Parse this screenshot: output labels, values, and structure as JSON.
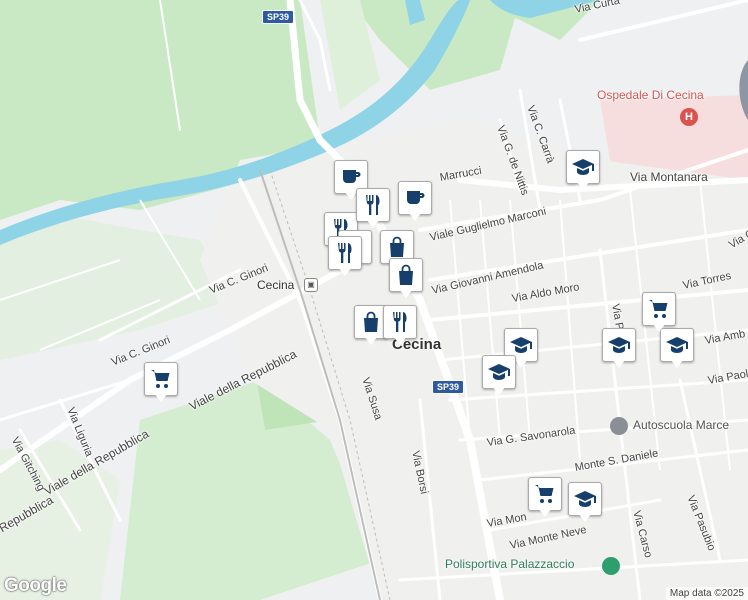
{
  "map": {
    "town": "Cecina",
    "station": "Cecina",
    "hospital": "Ospedale Di Cecina",
    "roads": {
      "sp39_top": "SP39",
      "sp39_bottom": "SP39",
      "via_curtatone": "Via Curta",
      "via_montanara": "Via Montanara",
      "via_marrucci": "Marrucci",
      "via_carra": "Via C. Carrà",
      "via_denittis": "Via G. de Nittis",
      "viale_marconi": "Viale Guglielmo Marconi",
      "via_amendola": "Via Giovanni Amendola",
      "via_aldo_moro": "Via Aldo Moro",
      "via_torres": "Via Torres",
      "via_pa": "Via Pa",
      "via_amb": "Via Amb",
      "via_paol": "Via Paol",
      "via_ginori": "Via C. Ginori",
      "via_ginori2": "Via C. Ginori",
      "viale_repubblica1": "Viale della Repubblica",
      "viale_repubblica2": "Viale della Repubblica",
      "viale_repubblica3": "Repubblica",
      "via_liguria": "Via Liguria",
      "via_gitching": "Via Gitching",
      "via_susa": "Via Susa",
      "via_borsi": "Via Borsi",
      "via_savonarola": "Via G. Savonarola",
      "via_monte_daniele": "Monte S. Daniele",
      "via_mon": "Via Mon",
      "via_monte_neve": "Via Monte Neve",
      "via_carso": "Via Carso",
      "via_pasubio": "Via Pasubio",
      "via_g": "Via G"
    },
    "pois": {
      "autoscuola": "Autoscuola Marce",
      "polisportiva": "Polisportiva Palazzaccio"
    },
    "markers": [
      {
        "icon": "coffee-icon",
        "type": "cafe"
      },
      {
        "icon": "coffee-icon",
        "type": "cafe"
      },
      {
        "icon": "restaurant-icon",
        "type": "restaurant"
      },
      {
        "icon": "restaurant-icon",
        "type": "restaurant"
      },
      {
        "icon": "restaurant-icon",
        "type": "restaurant"
      },
      {
        "icon": "shopping-bag-icon",
        "type": "shop"
      },
      {
        "icon": "shopping-bag-icon",
        "type": "shop"
      },
      {
        "icon": "shopping-bag-icon",
        "type": "shop"
      },
      {
        "icon": "restaurant-icon",
        "type": "restaurant"
      },
      {
        "icon": "restaurant-icon",
        "type": "restaurant"
      },
      {
        "icon": "school-icon",
        "type": "school"
      },
      {
        "icon": "school-icon",
        "type": "school"
      },
      {
        "icon": "school-icon",
        "type": "school"
      },
      {
        "icon": "school-icon",
        "type": "school"
      },
      {
        "icon": "school-icon",
        "type": "school"
      },
      {
        "icon": "school-icon",
        "type": "school"
      },
      {
        "icon": "shopping-cart-icon",
        "type": "supermarket"
      },
      {
        "icon": "shopping-cart-icon",
        "type": "supermarket"
      },
      {
        "icon": "shopping-cart-icon",
        "type": "supermarket"
      }
    ],
    "colors": {
      "marker_icon": "#16406b",
      "water": "#8fd4e6",
      "park": "#c6e8c0",
      "hospital": "#d9534f"
    }
  },
  "footer": {
    "logo": "Google",
    "attribution": "Map data ©2025"
  }
}
